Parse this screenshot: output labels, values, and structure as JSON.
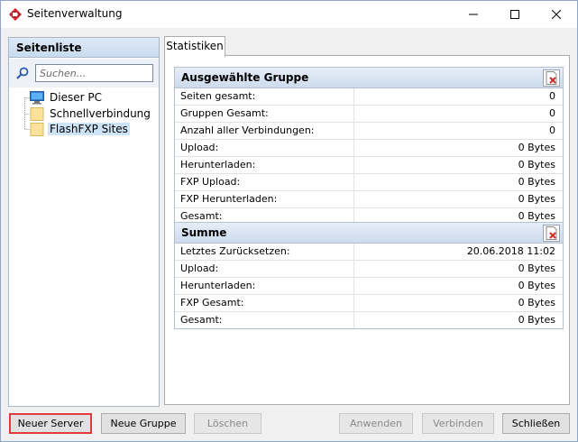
{
  "window": {
    "title": "Seitenverwaltung"
  },
  "sidebar": {
    "header": "Seitenliste",
    "search_placeholder": "Suchen...",
    "items": [
      {
        "label": "Dieser PC",
        "icon": "computer-icon"
      },
      {
        "label": "Schnellverbindung",
        "icon": "folder-icon"
      },
      {
        "label": "FlashFXP Sites",
        "icon": "folder-icon",
        "selected": true
      }
    ]
  },
  "tabs": [
    {
      "label": "Statistiken",
      "active": true
    }
  ],
  "group1": {
    "title": "Ausgewählte Gruppe",
    "rows": [
      {
        "label": "Seiten gesamt:",
        "value": "0"
      },
      {
        "label": "Gruppen Gesamt:",
        "value": "0"
      },
      {
        "label": "Anzahl aller Verbindungen:",
        "value": "0"
      },
      {
        "label": "Upload:",
        "value": "0 Bytes"
      },
      {
        "label": "Herunterladen:",
        "value": "0 Bytes"
      },
      {
        "label": "FXP Upload:",
        "value": "0 Bytes"
      },
      {
        "label": "FXP Herunterladen:",
        "value": "0 Bytes"
      },
      {
        "label": "Gesamt:",
        "value": "0 Bytes"
      }
    ]
  },
  "group2": {
    "title": "Summe",
    "rows": [
      {
        "label": "Letztes Zurücksetzen:",
        "value": "20.06.2018 11:02"
      },
      {
        "label": "Upload:",
        "value": "0 Bytes"
      },
      {
        "label": "Herunterladen:",
        "value": "0 Bytes"
      },
      {
        "label": "FXP Gesamt:",
        "value": "0 Bytes"
      },
      {
        "label": "Gesamt:",
        "value": "0 Bytes"
      }
    ]
  },
  "buttons": {
    "new_server": "Neuer Server",
    "new_group": "Neue Gruppe",
    "delete": "Löschen",
    "apply": "Anwenden",
    "connect": "Verbinden",
    "close": "Schließen"
  },
  "colors": {
    "highlight_border": "#e03c3c",
    "selection": "#cde4f7",
    "header_gradient": "#cddbec"
  }
}
